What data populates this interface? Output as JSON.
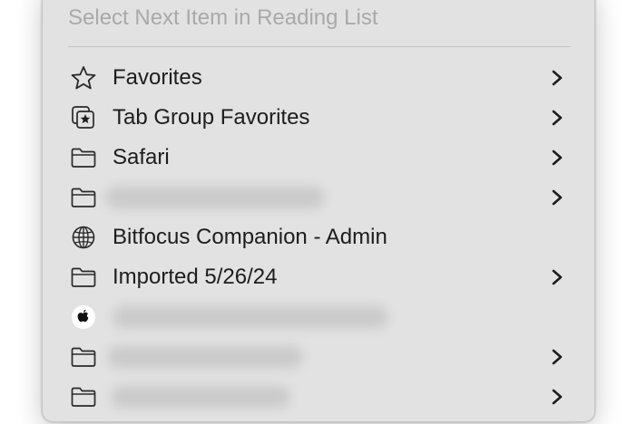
{
  "menu": {
    "header_item": "Select Next Item in Reading List",
    "items": [
      {
        "label": "Favorites",
        "icon": "star-icon",
        "submenu": true,
        "blurred": false
      },
      {
        "label": "Tab Group Favorites",
        "icon": "tab-group-star-icon",
        "submenu": true,
        "blurred": false
      },
      {
        "label": "Safari",
        "icon": "folder-icon",
        "submenu": true,
        "blurred": false
      },
      {
        "label": "",
        "icon": "folder-icon",
        "submenu": true,
        "blurred": true
      },
      {
        "label": "Bitfocus Companion - Admin",
        "icon": "globe-icon",
        "submenu": false,
        "blurred": false
      },
      {
        "label": "Imported 5/26/24",
        "icon": "folder-icon",
        "submenu": true,
        "blurred": false
      },
      {
        "label": "",
        "icon": "apple-icon",
        "submenu": false,
        "blurred": true
      },
      {
        "label": "",
        "icon": "folder-icon",
        "submenu": true,
        "blurred": true
      },
      {
        "label": "",
        "icon": "folder-icon",
        "submenu": true,
        "blurred": true
      }
    ]
  },
  "colors": {
    "menu_background": "#e2e2e2",
    "text": "#1d1d1d",
    "disabled_text": "#a9a9a9"
  }
}
